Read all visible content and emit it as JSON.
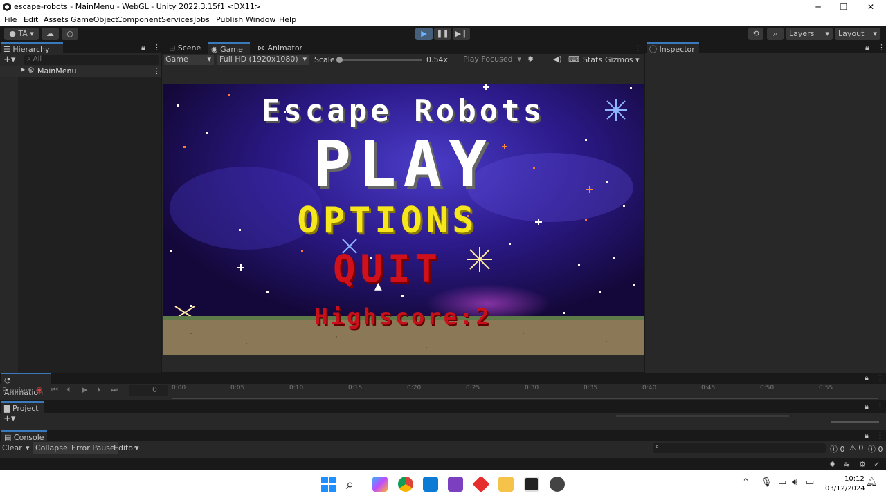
{
  "window": {
    "title": "escape-robots - MainMenu - WebGL - Unity 2022.3.15f1 <DX11>",
    "minimize": "─",
    "maximize": "❐",
    "close": "✕"
  },
  "menu": {
    "items": [
      "File",
      "Edit",
      "Assets",
      "GameObject",
      "Component",
      "Services",
      "Jobs",
      "Publish",
      "Window",
      "Help"
    ]
  },
  "toolbar": {
    "account_label": "TA",
    "layers_label": "Layers",
    "layout_label": "Layout"
  },
  "hierarchy": {
    "tab_label": "Hierarchy",
    "search_placeholder": "All",
    "scene_name": "MainMenu"
  },
  "center_tabs": {
    "scene": "Scene",
    "game": "Game",
    "animator": "Animator"
  },
  "game_toolbar": {
    "display": "Game",
    "resolution": "Full HD (1920x1080)",
    "scale_label": "Scale",
    "scale_value": "0.54x",
    "play_mode": "Play Focused",
    "stats": "Stats",
    "gizmos": "Gizmos"
  },
  "game": {
    "title": "Escape Robots",
    "play": "PLAY",
    "options": "OPTIONS",
    "quit": "QUIT",
    "highscore": "Highscore:2",
    "colors": {
      "title": "#ffffff",
      "play": "#ffffff",
      "options": "#f5e61e",
      "quit": "#d0101a",
      "highscore": "#c8101a",
      "sky": "#2a1670",
      "ground": "#8a7856"
    }
  },
  "inspector": {
    "tab_label": "Inspector"
  },
  "animation": {
    "tab_label": "Animation",
    "preview_label": "Preview",
    "frame_value": "0",
    "ticks": [
      "0:00",
      "0:05",
      "0:10",
      "0:15",
      "0:20",
      "0:25",
      "0:30",
      "0:35",
      "0:40",
      "0:45",
      "0:50",
      "0:55"
    ]
  },
  "project": {
    "tab_label": "Project"
  },
  "console": {
    "tab_label": "Console",
    "clear": "Clear",
    "collapse": "Collapse",
    "error_pause": "Error Pause",
    "editor": "Editor",
    "log_count": "0",
    "warn_count": "0",
    "error_count": "0"
  },
  "taskbar": {
    "time": "10:12",
    "date": "03/12/2024",
    "icons": [
      "windows-start-icon",
      "search-icon",
      "copilot-icon",
      "chrome-icon",
      "vscode-icon",
      "visual-studio-icon",
      "git-icon",
      "file-explorer-icon",
      "unity-icon",
      "unity-hub-icon"
    ]
  }
}
